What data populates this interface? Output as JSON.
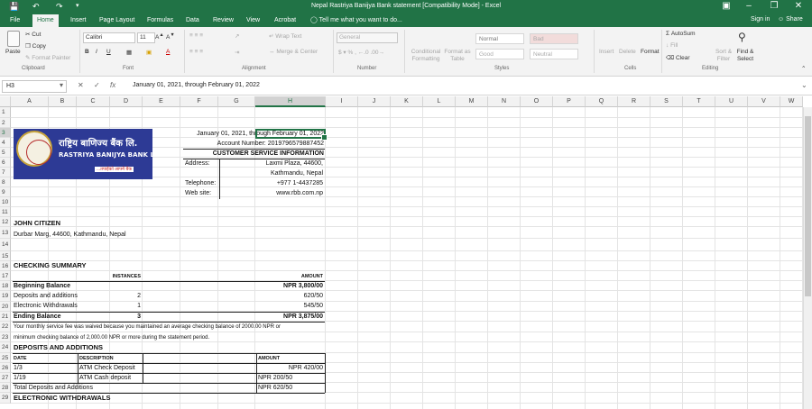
{
  "title_bar": {
    "document_title": "Nepal Rastriya Banijya Bank statement  [Compatibility Mode] - Excel",
    "save_icon": "save-icon",
    "undo_icon": "undo-icon",
    "redo_icon": "redo-icon"
  },
  "tabs": [
    "File",
    "Home",
    "Insert",
    "Page Layout",
    "Formulas",
    "Data",
    "Review",
    "View",
    "Acrobat"
  ],
  "active_tab": "Home",
  "tell_me": "Tell me what you want to do...",
  "sign_in": "Sign in",
  "share": "Share",
  "ribbon": {
    "clipboard": {
      "paste": "Paste",
      "cut": "Cut",
      "copy": "Copy",
      "format_painter": "Format Painter",
      "label": "Clipboard"
    },
    "font": {
      "name": "Calibri",
      "size": "11",
      "label": "Font",
      "bold": "B",
      "italic": "I",
      "underline": "U"
    },
    "alignment": {
      "wrap_text": "Wrap Text",
      "merge_center": "Merge & Center",
      "label": "Alignment"
    },
    "number": {
      "format": "General",
      "label": "Number"
    },
    "styles": {
      "conditional": "Conditional Formatting",
      "format_as_table": "Format as Table",
      "normal": "Normal",
      "bad": "Bad",
      "good": "Good",
      "neutral": "Neutral",
      "label": "Styles"
    },
    "cells": {
      "insert": "Insert",
      "delete": "Delete",
      "format": "Format",
      "label": "Cells"
    },
    "editing": {
      "autosum": "AutoSum",
      "fill": "Fill",
      "clear": "Clear",
      "sort_filter": "Sort & Filter",
      "find_select": "Find & Select",
      "label": "Editing"
    }
  },
  "formula_bar": {
    "name_box": "H3",
    "formula": "January 01, 2021,  through February 01, 2022"
  },
  "columns": [
    "A",
    "B",
    "C",
    "D",
    "E",
    "F",
    "G",
    "H",
    "I",
    "J",
    "K",
    "L",
    "M",
    "N",
    "O",
    "P",
    "Q",
    "R",
    "S",
    "T",
    "U",
    "V",
    "W"
  ],
  "rows": [
    "1",
    "2",
    "3",
    "4",
    "5",
    "6",
    "7",
    "8",
    "9",
    "10",
    "11",
    "12",
    "13",
    "14",
    "15",
    "16",
    "17",
    "18",
    "19",
    "20",
    "21",
    "22",
    "23",
    "24",
    "25",
    "26",
    "27",
    "28",
    "29"
  ],
  "logo": {
    "line1": "राष्ट्रिय बाणिज्य बैंक लि.",
    "line2": "RASTRIYA BANIJYA BANK LTD.",
    "line3": "...तपाईंको आफ्नै बैंक"
  },
  "sheet": {
    "period": "January 01, 2021,  through February 01, 2022",
    "account_number": "Account Number: 2019796579887452",
    "customer_service": "CUSTOMER SERVICE INFORMATION",
    "address_label": "Address:",
    "address_line1": "Laxmi Plaza, 44600,",
    "address_line2": "Kathmandu, Nepal",
    "telephone_label": "Telephone:",
    "telephone": "+977 1-4437285",
    "website_label": "Web site:",
    "website": "www.rbb.com.np",
    "customer_name": "JOHN CITIZEN",
    "customer_address": "Durbar Marg, 44600, Kathmandu, Nepal",
    "checking_summary": "CHECKING SUMMARY",
    "instances_header": "INSTANCES",
    "amount_header": "AMOUNT",
    "beginning_balance": "Beginning Balance",
    "beginning_amount": "NPR 3,800/00",
    "deposits_label": "Deposits and additions",
    "deposits_count": "2",
    "deposits_amount": "620/50",
    "withdrawals_label": "Electronic Withdrawals",
    "withdrawals_count": "1",
    "withdrawals_amount": "545/50",
    "ending_balance": "Ending Balance",
    "ending_count": "3",
    "ending_amount": "NPR 3,875/00",
    "note1": "Your monthly service fee was waived because you maintained an average checking balance of 2000.00 NPR or",
    "note2": "minimum checking balance of 2,000.00 NPR or more during the statement period.",
    "deposits_section": "DEPOSITS AND ADDITIONS",
    "date_header": "DATE",
    "description_header": "DESCRIPTION",
    "amount_header2": "AMOUNT",
    "row1_date": "1/3",
    "row1_desc": "ATM Check Deposit",
    "row1_amount": "NPR 420/00",
    "row2_date": "1/19",
    "row2_desc": "ATM Cash deposit",
    "row2_amount": "NPR 200/50",
    "total_deposits": "Total Deposits and Additions",
    "total_amount": "NPR 620/50",
    "withdrawals_section": "ELECTRONIC WITHDRAWALS"
  }
}
